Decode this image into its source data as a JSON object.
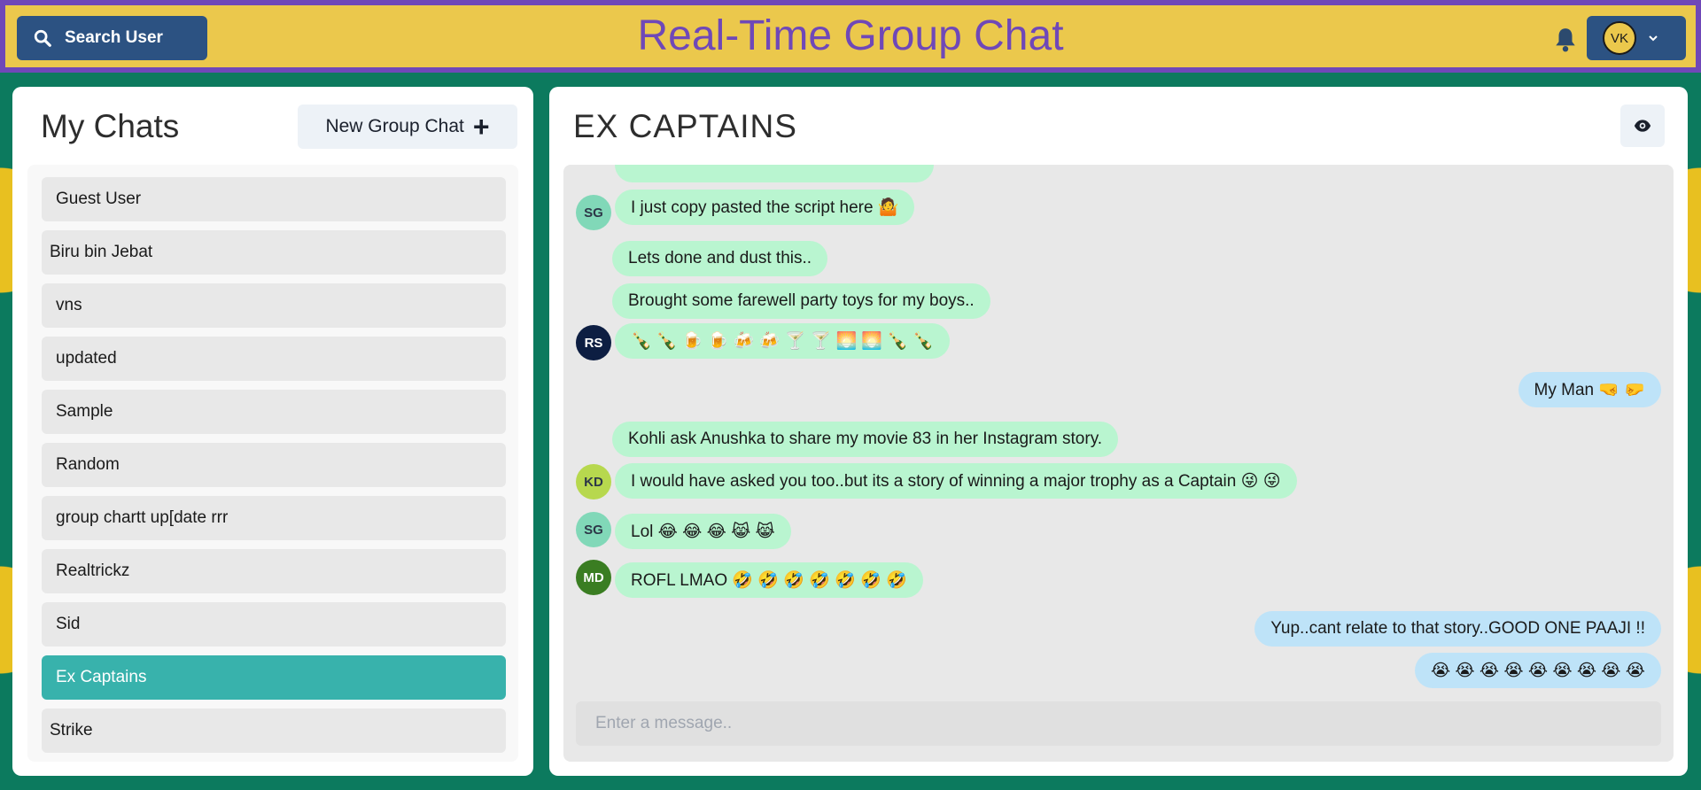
{
  "header": {
    "search_label": "Search User",
    "title": "Real-Time Group Chat",
    "user_initials": "VK",
    "colors": {
      "bar": "#ebc84c",
      "border": "#6f48b8",
      "button": "#2c5282"
    }
  },
  "sidebar": {
    "title": "My Chats",
    "new_group_label": "New Group Chat",
    "new_group_icon": "+",
    "chats": [
      {
        "label": "Guest User"
      },
      {
        "label": "Biru bin Jebat"
      },
      {
        "label": "vns"
      },
      {
        "label": "updated"
      },
      {
        "label": "Sample"
      },
      {
        "label": "Random"
      },
      {
        "label": "group chartt up[date rrr"
      },
      {
        "label": "Realtrickz"
      },
      {
        "label": "Sid"
      },
      {
        "label": "Ex Captains",
        "active": true
      },
      {
        "label": "Strike"
      }
    ]
  },
  "chat": {
    "title": "EX CAPTAINS",
    "input_placeholder": "Enter a message..",
    "messages": [
      {
        "sender": "SG",
        "text": "I just copy pasted the script here 🤷",
        "side": "in"
      },
      {
        "sender": "RS",
        "text": "Lets done and dust this..",
        "side": "in"
      },
      {
        "sender": "RS",
        "text": "Brought some farewell party toys for my boys..",
        "side": "in"
      },
      {
        "sender": "RS",
        "text": "🍾 🍾 🍺 🍺 🍻 🍻 🍸 🍸 🌅 🌅 🍾 🍾",
        "side": "in"
      },
      {
        "sender": "VK",
        "text": "My Man 🤜 🤛",
        "side": "out"
      },
      {
        "sender": "KD",
        "text": "Kohli ask Anushka to share my movie 83 in her Instagram story.",
        "side": "in"
      },
      {
        "sender": "KD",
        "text": "I would have asked you too..but its a story of winning a major trophy as a Captain 😜 😜",
        "side": "in"
      },
      {
        "sender": "SG",
        "text": "Lol 😂 😂 😂 😹 😹",
        "side": "in"
      },
      {
        "sender": "MD",
        "text": "ROFL LMAO 🤣 🤣 🤣 🤣 🤣 🤣 🤣",
        "side": "in"
      },
      {
        "sender": "VK",
        "text": "Yup..cant relate to that story..GOOD ONE PAAJI !!",
        "side": "out"
      },
      {
        "sender": "VK",
        "text": "😭 😭 😭 😭 😭 😭 😭 😭 😭",
        "side": "out"
      }
    ],
    "avatars": {
      "SG": {
        "initials": "SG",
        "bg": "#81d8b8",
        "fg": "#2d3748"
      },
      "RS": {
        "initials": "RS",
        "bg": "#0d1e42",
        "fg": "#ffffff"
      },
      "KD": {
        "initials": "KD",
        "bg": "#b7d84e",
        "fg": "#2d3748"
      },
      "MD": {
        "initials": "MD",
        "bg": "#3a7d22",
        "fg": "#ffffff"
      }
    }
  }
}
